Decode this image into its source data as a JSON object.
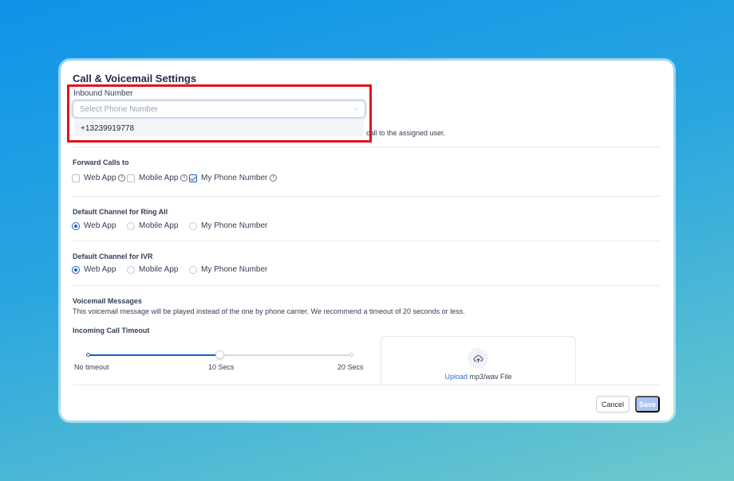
{
  "settings": {
    "title": "Call & Voicemail Settings",
    "inbound_label": "Inbound Number",
    "inbound_placeholder": "Select Phone Number",
    "inbound_option": "+13239919778",
    "assigned_text": "call to the assigned user."
  },
  "forward": {
    "label": "Forward Calls to",
    "options": [
      {
        "label": "Web App",
        "checked": false
      },
      {
        "label": "Mobile App",
        "checked": false
      },
      {
        "label": "My Phone Number",
        "checked": true
      }
    ]
  },
  "ring_all": {
    "label": "Default Channel for Ring All",
    "options": [
      {
        "label": "Web App",
        "selected": true
      },
      {
        "label": "Mobile App",
        "selected": false
      },
      {
        "label": "My Phone Number",
        "selected": false
      }
    ]
  },
  "ivr": {
    "label": "Default Channel for IVR",
    "options": [
      {
        "label": "Web App",
        "selected": true
      },
      {
        "label": "Mobile App",
        "selected": false
      },
      {
        "label": "My Phone Number",
        "selected": false
      }
    ]
  },
  "voicemail": {
    "label": "Voicemail Messages",
    "description": "This voicemail message will be played instead of the one by phone carrier. We recommend a timeout of 20 seconds or less.",
    "timeout_label": "Incoming Call Timeout",
    "slider": {
      "min_label": "No timeout",
      "mid_label": "10 Secs",
      "max_label": "20 Secs",
      "value_fraction": 0.5
    },
    "upload_link": "Upload",
    "upload_text": "mp3/wav File"
  },
  "actions": {
    "cancel": "Cancel",
    "save": "Save"
  },
  "colors": {
    "accent": "#1d5ec9",
    "highlight": "#e0141e",
    "save_disabled": "#a9c4f5"
  }
}
